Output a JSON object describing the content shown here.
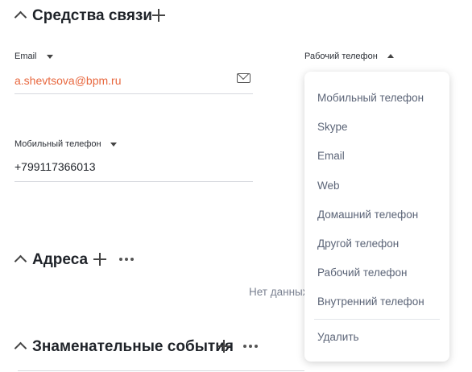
{
  "sections": {
    "communications": {
      "title": "Средства связи"
    },
    "addresses": {
      "title": "Адреса",
      "empty_text": "Нет данных"
    },
    "events": {
      "title": "Знаменательные события"
    }
  },
  "fields": {
    "email": {
      "label": "Email",
      "value": "a.shevtsova@bpm.ru"
    },
    "work_phone": {
      "label": "Рабочий телефон"
    },
    "mobile_phone": {
      "label": "Мобильный телефон",
      "value": "+799117366013"
    }
  },
  "dropdown": {
    "items": [
      "Мобильный телефон",
      "Skype",
      "Email",
      "Web",
      "Домашний телефон",
      "Другой телефон",
      "Рабочий телефон",
      "Внутренний телефон"
    ],
    "delete_label": "Удалить"
  },
  "colors": {
    "email_link": "#e8683f",
    "text": "#1f2329",
    "menu_text": "#5b6477"
  }
}
